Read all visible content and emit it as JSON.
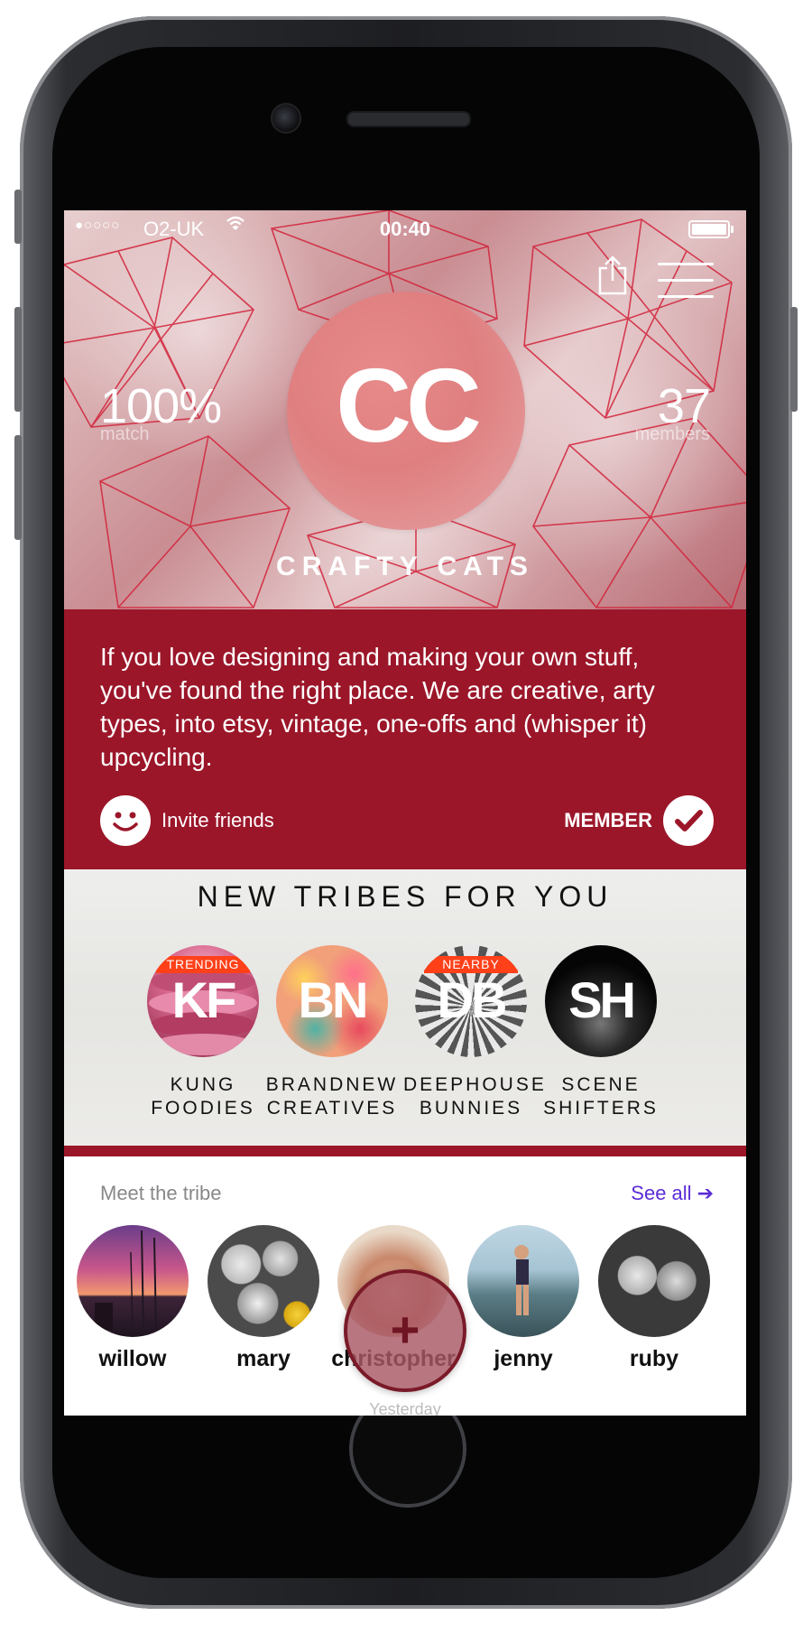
{
  "status_bar": {
    "signal": "●○○○○",
    "carrier": "O2-UK",
    "time": "00:40"
  },
  "header": {
    "share_icon": "share-icon",
    "menu_icon": "menu-icon"
  },
  "tribe": {
    "initials": "CC",
    "name": "CRAFTY CATS",
    "match_value": "100%",
    "match_label": "match",
    "members_value": "37",
    "members_label": "members",
    "description": "If you love designing and making your own stuff, you've found the right place. We are creative, arty types, into etsy, vintage, one-offs and (whisper it) upcycling.",
    "invite_label": "Invite friends",
    "member_label": "MEMBER"
  },
  "new_tribes": {
    "title": "NEW TRIBES FOR YOU",
    "items": [
      {
        "initials": "KF",
        "badge": "TRENDING",
        "line1": "KUNG",
        "line2": "FOODIES"
      },
      {
        "initials": "BN",
        "badge": "",
        "line1": "BRANDNEW",
        "line2": "CREATIVES"
      },
      {
        "initials": "DB",
        "badge": "NEARBY",
        "line1": "DEEPHOUSE",
        "line2": "BUNNIES"
      },
      {
        "initials": "SH",
        "badge": "",
        "line1": "SCENE",
        "line2": "SHIFTERS"
      }
    ]
  },
  "meet": {
    "title": "Meet the tribe",
    "see_all": "See all",
    "people": [
      {
        "name": "willow"
      },
      {
        "name": "mary"
      },
      {
        "name": "christopher"
      },
      {
        "name": "jenny"
      },
      {
        "name": "ruby"
      }
    ],
    "footer": "Yesterday"
  },
  "fab": {
    "label": "+"
  },
  "colors": {
    "brand_red": "#9b1629",
    "logo_pink": "#df7f80",
    "badge_orange": "#ff4019",
    "link_purple": "#5b2cd6"
  }
}
